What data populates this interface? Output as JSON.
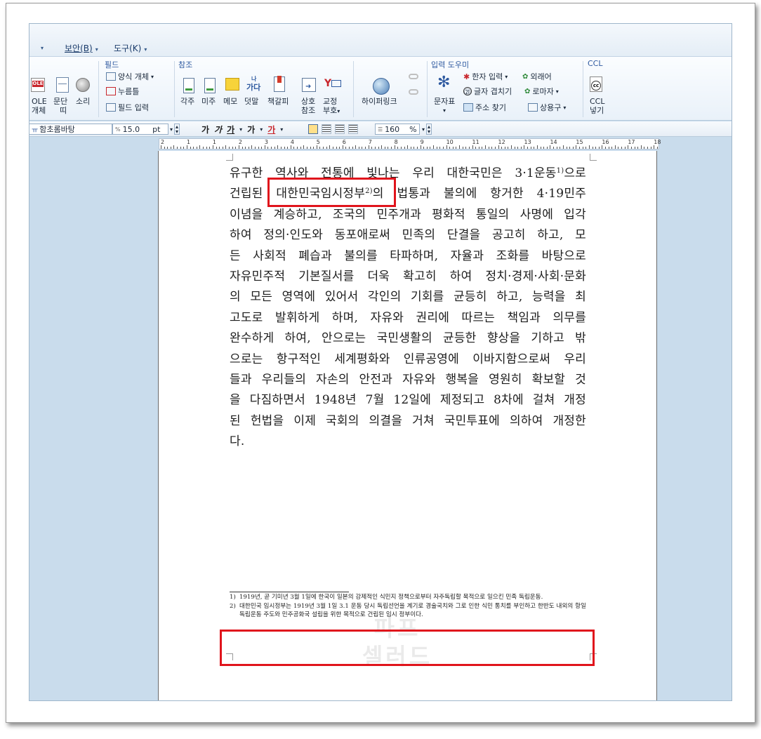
{
  "menu": {
    "security": "보안(B)",
    "tools": "도구(K)"
  },
  "ribbon": {
    "left_group": {
      "ole": "OLE",
      "ole_label1": "OLE",
      "ole_label2": "개체",
      "para_label1": "문단",
      "para_label2": "띠",
      "sound_label": "소리"
    },
    "field_group": {
      "title": "필드",
      "form_object": "양식 개체",
      "click_here": "누름틀",
      "field_input": "필드 입력"
    },
    "ref_group": {
      "title": "참조",
      "footnote": "각주",
      "endnote": "미주",
      "memo": "메모",
      "dot_char": "덧말",
      "bookmark": "책갈피",
      "cross_ref1": "상호",
      "cross_ref2": "참조",
      "proof1": "교정",
      "proof2": "부호",
      "hyperlink": "하이퍼링크",
      "garu_icon": "가다",
      "garu_top": "나"
    },
    "input_group": {
      "title": "입력 도우미",
      "char_map": "문자표",
      "hanja_input": "한자 입력",
      "foreign": "외래어",
      "overlap": "글자 겹치기",
      "roman": "로마자",
      "address": "주소 찾기",
      "phrases": "상용구"
    },
    "ccl_group": {
      "title": "CCL",
      "label1": "CCL",
      "label2": "넣기",
      "icon_text": "cc"
    }
  },
  "format_bar": {
    "font": "함초롬바탕",
    "size": "15.0",
    "unit": "pt",
    "bold": "가",
    "italic": "가",
    "underline": "가",
    "strike": "가",
    "color": "가",
    "line_spacing": "160",
    "line_unit": "%"
  },
  "ruler": {
    "numbers": [
      "2",
      "1",
      "1",
      "2",
      "3",
      "4",
      "5",
      "6",
      "7",
      "8",
      "9",
      "10",
      "11",
      "12",
      "13",
      "14",
      "15",
      "16",
      "17",
      "18"
    ]
  },
  "document": {
    "lines": [
      "유구한 역사와 전통에 빛나는 우리 대한국민은 3·1운동",
      "건립된 ",
      "이념을 계승하고, 조국의 민주개과 평화적 통일의 사명에 입각",
      "하여 정의·인도와 동포애로써 민족의 단결을 공고히 하고, 모",
      "든 사회적 폐습과 불의를 타파하며, 자율과 조화를 바탕으로",
      "자유민주적 기본질서를 더욱 확고히 하여 정치·경제·사회·문화",
      "의 모든 영역에 있어서 각인의 기회를 균등히 하고, 능력을 최",
      "고도로 발휘하게 하며, 자유와 권리에 따르는 책임과 의무를",
      "완수하게 하여, 안으로는 국민생활의 균등한 향상을 기하고 밖",
      "으로는 항구적인 세계평화와 인류공영에 이바지함으로써 우리",
      "들과 우리들의 자손의 안전과 자유와 행복을 영원히 확보할 것",
      "을 다짐하면서 1948년 7월 12일에 제정되고 8차에 걸쳐 개정",
      "된 헌법을 이제 국회의 의결을 거쳐 국민투표에 의하여 개정한",
      "다."
    ],
    "line1_sup": "1)",
    "line1_tail": "으로",
    "line2_highlight": "대한민국임시정부",
    "line2_sup": "2)",
    "line2_rest": "의 법통과 불의에 항거한 4·19민주",
    "footnotes": [
      {
        "num": "1)",
        "text": "1919년, 곧 기미년 3월 1일에 한국이 일본의 강제적인 식민지 정책으로부터 자주독립할 목적으로 일으킨 민족 독립운동."
      },
      {
        "num": "2)",
        "text": "대한민국 임시정부는 1919년 3월 1일 3.1 운동 당시 독립선언을 계기로 경술국치와 그로 인한 식민 통치를 부인하고 한반도 내외의 항일 독립운동 주도와 민주공화국 설립을 위한 목적으로 건립된 임시 정부이다."
      }
    ],
    "watermark": [
      "파프",
      "셀러드"
    ]
  },
  "colors": {
    "highlight": "#e0141c",
    "app_bg": "#c9dcec",
    "group_title": "#2f5aa0"
  }
}
